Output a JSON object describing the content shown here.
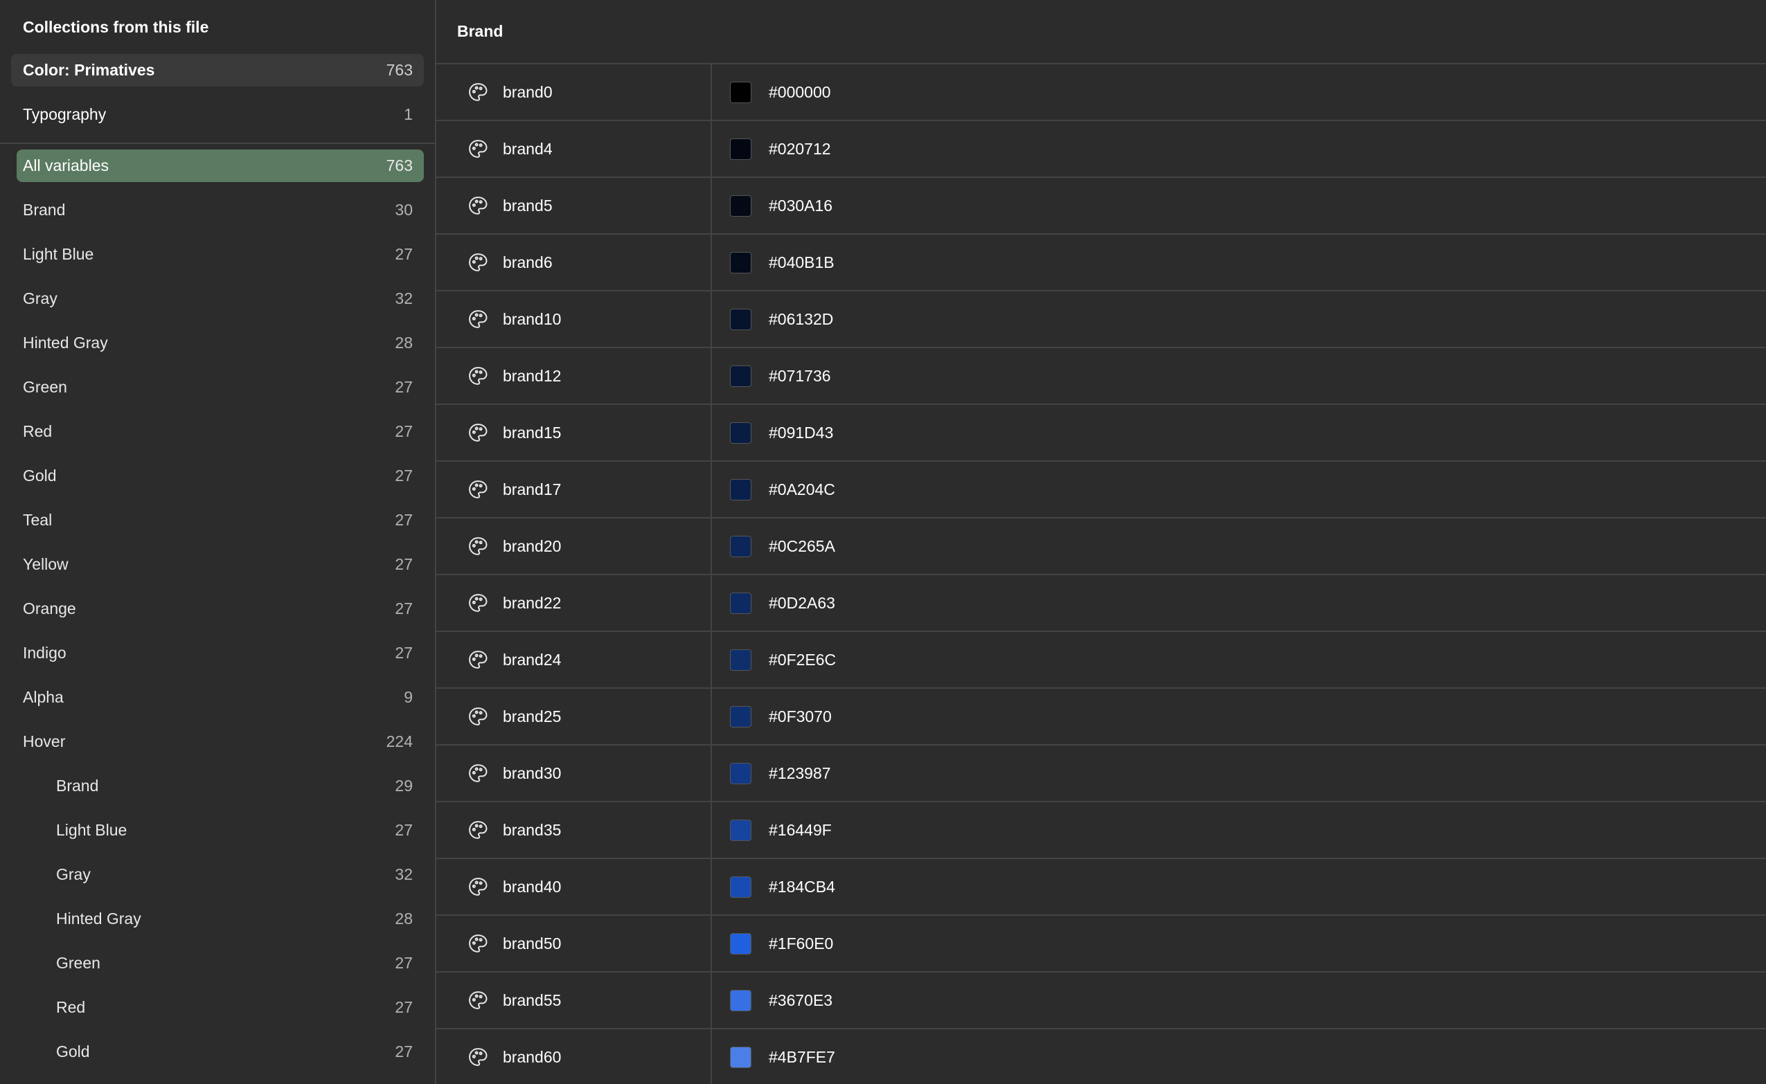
{
  "sidebar": {
    "title": "Collections from this file",
    "collections": [
      {
        "label": "Color: Primatives",
        "count": "763",
        "selected": true
      },
      {
        "label": "Typography",
        "count": "1",
        "selected": false
      }
    ],
    "groups": [
      {
        "label": "All variables",
        "count": "763",
        "active": true,
        "sub": false
      },
      {
        "label": "Brand",
        "count": "30",
        "active": false,
        "sub": false
      },
      {
        "label": "Light Blue",
        "count": "27",
        "active": false,
        "sub": false
      },
      {
        "label": "Gray",
        "count": "32",
        "active": false,
        "sub": false
      },
      {
        "label": "Hinted Gray",
        "count": "28",
        "active": false,
        "sub": false
      },
      {
        "label": "Green",
        "count": "27",
        "active": false,
        "sub": false
      },
      {
        "label": "Red",
        "count": "27",
        "active": false,
        "sub": false
      },
      {
        "label": "Gold",
        "count": "27",
        "active": false,
        "sub": false
      },
      {
        "label": "Teal",
        "count": "27",
        "active": false,
        "sub": false
      },
      {
        "label": "Yellow",
        "count": "27",
        "active": false,
        "sub": false
      },
      {
        "label": "Orange",
        "count": "27",
        "active": false,
        "sub": false
      },
      {
        "label": "Indigo",
        "count": "27",
        "active": false,
        "sub": false
      },
      {
        "label": "Alpha",
        "count": "9",
        "active": false,
        "sub": false
      },
      {
        "label": "Hover",
        "count": "224",
        "active": false,
        "sub": false
      },
      {
        "label": "Brand",
        "count": "29",
        "active": false,
        "sub": true
      },
      {
        "label": "Light Blue",
        "count": "27",
        "active": false,
        "sub": true
      },
      {
        "label": "Gray",
        "count": "32",
        "active": false,
        "sub": true
      },
      {
        "label": "Hinted Gray",
        "count": "28",
        "active": false,
        "sub": true
      },
      {
        "label": "Green",
        "count": "27",
        "active": false,
        "sub": true
      },
      {
        "label": "Red",
        "count": "27",
        "active": false,
        "sub": true
      },
      {
        "label": "Gold",
        "count": "27",
        "active": false,
        "sub": true
      }
    ]
  },
  "main": {
    "header": "Brand",
    "row_icon": "palette-icon",
    "variables": [
      {
        "name": "brand0",
        "hex": "#000000",
        "color": "#000000"
      },
      {
        "name": "brand4",
        "hex": "#020712",
        "color": "#020712"
      },
      {
        "name": "brand5",
        "hex": "#030A16",
        "color": "#030A16"
      },
      {
        "name": "brand6",
        "hex": "#040B1B",
        "color": "#040B1B"
      },
      {
        "name": "brand10",
        "hex": "#06132D",
        "color": "#06132D"
      },
      {
        "name": "brand12",
        "hex": "#071736",
        "color": "#071736"
      },
      {
        "name": "brand15",
        "hex": "#091D43",
        "color": "#091D43"
      },
      {
        "name": "brand17",
        "hex": "#0A204C",
        "color": "#0A204C"
      },
      {
        "name": "brand20",
        "hex": "#0C265A",
        "color": "#0C265A"
      },
      {
        "name": "brand22",
        "hex": "#0D2A63",
        "color": "#0D2A63"
      },
      {
        "name": "brand24",
        "hex": "#0F2E6C",
        "color": "#0F2E6C"
      },
      {
        "name": "brand25",
        "hex": "#0F3070",
        "color": "#0F3070"
      },
      {
        "name": "brand30",
        "hex": "#123987",
        "color": "#123987"
      },
      {
        "name": "brand35",
        "hex": "#16449F",
        "color": "#16449F"
      },
      {
        "name": "brand40",
        "hex": "#184CB4",
        "color": "#184CB4"
      },
      {
        "name": "brand50",
        "hex": "#1F60E0",
        "color": "#1F60E0"
      },
      {
        "name": "brand55",
        "hex": "#3670E3",
        "color": "#3670E3"
      },
      {
        "name": "brand60",
        "hex": "#4B7FE7",
        "color": "#4B7FE7"
      }
    ]
  }
}
